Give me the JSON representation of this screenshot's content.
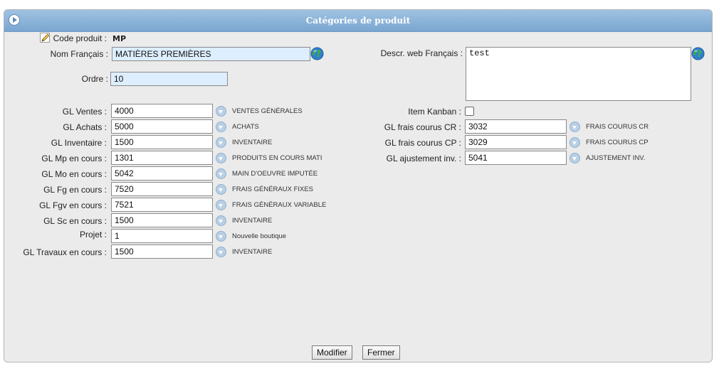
{
  "window": {
    "title": "Catégories de produit"
  },
  "code_produit": {
    "label": "Code produit :",
    "value": "MP"
  },
  "nom_francais": {
    "label": "Nom Français :",
    "value": "MATIÈRES PREMIÈRES"
  },
  "ordre": {
    "label": "Ordre :",
    "value": "10"
  },
  "descr_web": {
    "label": "Descr. web Français :",
    "value": "test"
  },
  "left_gl": [
    {
      "label": "GL Ventes :",
      "value": "4000",
      "desc": "VENTES GÉNÉRALES"
    },
    {
      "label": "GL Achats :",
      "value": "5000",
      "desc": "ACHATS"
    },
    {
      "label": "GL Inventaire :",
      "value": "1500",
      "desc": "INVENTAIRE"
    },
    {
      "label": "GL Mp en cours :",
      "value": "1301",
      "desc": "PRODUITS EN COURS MATI"
    },
    {
      "label": "GL Mo en cours :",
      "value": "5042",
      "desc": "MAIN D'OEUVRE IMPUTÉE"
    },
    {
      "label": "GL Fg en cours :",
      "value": "7520",
      "desc": "FRAIS GÉNÉRAUX FIXES"
    },
    {
      "label": "GL Fgv en cours :",
      "value": "7521",
      "desc": "FRAIS GÉNÉRAUX VARIABLE"
    },
    {
      "label": "GL Sc en cours :",
      "value": "1500",
      "desc": "INVENTAIRE"
    },
    {
      "label": "Projet :",
      "value": "1",
      "desc": "Nouvelle boutique"
    },
    {
      "label": "GL Travaux en cours :",
      "value": "1500",
      "desc": "INVENTAIRE"
    }
  ],
  "item_kanban": {
    "label": "Item Kanban :",
    "checked": false
  },
  "right_gl": [
    {
      "label": "GL frais courus CR :",
      "value": "3032",
      "desc": "FRAIS COURUS CR"
    },
    {
      "label": "GL frais courus CP :",
      "value": "3029",
      "desc": "FRAIS COURUS CP"
    },
    {
      "label": "GL ajustement inv. :",
      "value": "5041",
      "desc": "AJUSTEMENT INV."
    }
  ],
  "buttons": {
    "modifier": "Modifier",
    "fermer": "Fermer"
  },
  "icons": {
    "edit": "pencil-icon",
    "translate": "globe-icon",
    "lookup": "dropdown-circle-icon",
    "collapse": "circle-arrow-icon"
  },
  "colors": {
    "titlebar": "#8bb3da",
    "highlight_field": "#ddeeff",
    "panel_bg": "#ebebeb"
  }
}
